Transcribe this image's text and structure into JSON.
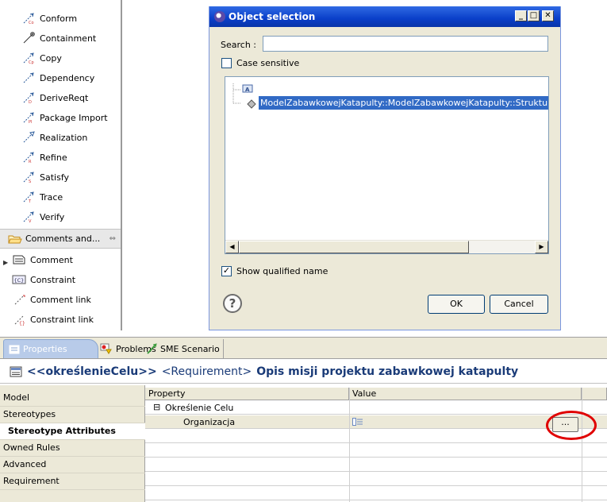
{
  "palette": {
    "items": [
      {
        "label": "Conform",
        "icon": "conform-icon"
      },
      {
        "label": "Containment",
        "icon": "containment-icon"
      },
      {
        "label": "Copy",
        "icon": "copy-icon"
      },
      {
        "label": "Dependency",
        "icon": "dependency-icon"
      },
      {
        "label": "DeriveReqt",
        "icon": "derive-reqt-icon"
      },
      {
        "label": "Package Import",
        "icon": "package-import-icon"
      },
      {
        "label": "Realization",
        "icon": "realization-icon"
      },
      {
        "label": "Refine",
        "icon": "refine-icon"
      },
      {
        "label": "Satisfy",
        "icon": "satisfy-icon"
      },
      {
        "label": "Trace",
        "icon": "trace-icon"
      },
      {
        "label": "Verify",
        "icon": "verify-icon"
      }
    ],
    "drawer_label": "Comments and...",
    "sub_items": [
      {
        "label": "Comment",
        "icon": "comment-icon"
      },
      {
        "label": "Constraint",
        "icon": "constraint-icon"
      },
      {
        "label": "Comment link",
        "icon": "comment-link-icon"
      },
      {
        "label": "Constraint link",
        "icon": "constraint-link-icon"
      }
    ]
  },
  "dialog": {
    "title": "Object selection",
    "search_label": "Search :",
    "search_value": "",
    "case_sensitive_label": "Case sensitive",
    "case_sensitive_checked": false,
    "tree_selected": "ModelZabawkowejKatapulty::ModelZabawkowejKatapulty::Struktura::",
    "show_qualified_label": "Show qualified name",
    "show_qualified_checked": true,
    "ok_label": "OK",
    "cancel_label": "Cancel",
    "help_glyph": "?"
  },
  "properties": {
    "tabs": [
      "Properties",
      "Problems",
      "SME Scenario"
    ],
    "header": {
      "stereotype": "<<określenieCelu>>",
      "type": "<Requirement>",
      "name": "Opis misji projektu zabawkowej katapulty"
    },
    "nav": [
      "Model",
      "Stereotypes",
      "Stereotype Attributes",
      "Owned Rules",
      "Advanced",
      "Requirement"
    ],
    "nav_active": "Stereotype Attributes",
    "grid": {
      "col_property": "Property",
      "col_value": "Value",
      "group_toggle": "⊟",
      "group": "Określenie Celu",
      "row_property": "Organizacja",
      "row_value": "",
      "edit_button": "..."
    }
  },
  "colors": {
    "title_bar": "#0a3fc9",
    "selection": "#316ac5",
    "highlight_circle": "#e00000"
  }
}
